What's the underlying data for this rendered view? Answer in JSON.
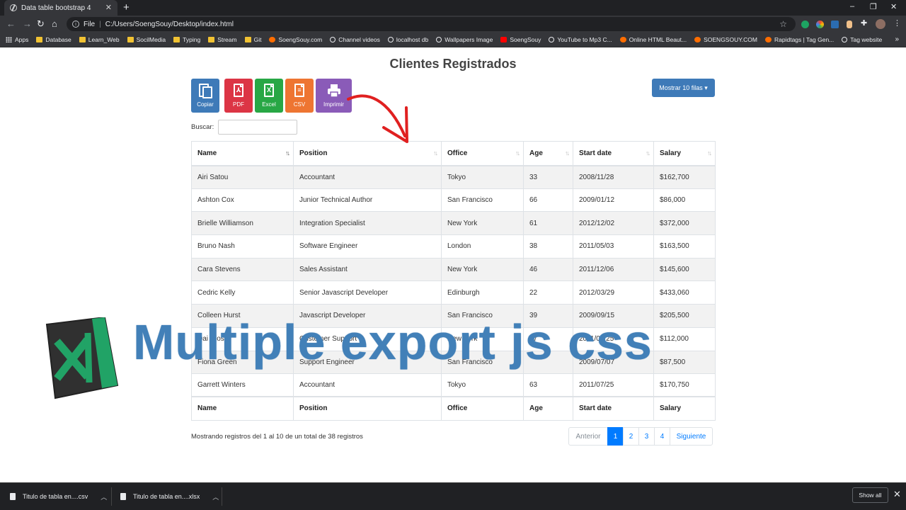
{
  "browser": {
    "tab_title": "Data table bootstrap 4",
    "tab_close": "✕",
    "new_tab": "+",
    "window_controls": [
      "–",
      "❐",
      "✕"
    ],
    "address": {
      "scheme": "File",
      "path": "C:/Users/SoengSouy/Desktop/index.html"
    },
    "bookmarks": [
      {
        "label": "Apps",
        "icon": "apps-icon"
      },
      {
        "label": "Database",
        "icon": "folder-icon"
      },
      {
        "label": "Learn_Web",
        "icon": "folder-icon"
      },
      {
        "label": "SocilMedia",
        "icon": "folder-icon"
      },
      {
        "label": "Typing",
        "icon": "folder-icon"
      },
      {
        "label": "Stream",
        "icon": "folder-icon"
      },
      {
        "label": "Git",
        "icon": "folder-icon"
      },
      {
        "label": "SoengSouy.com",
        "icon": "site-icon"
      },
      {
        "label": "Channel videos",
        "icon": "globe-icon"
      },
      {
        "label": "localhost db",
        "icon": "globe-icon"
      },
      {
        "label": "Wallpapers Image",
        "icon": "globe-icon"
      },
      {
        "label": "SoengSouy",
        "icon": "youtube-icon"
      },
      {
        "label": "YouTube to Mp3 C...",
        "icon": "globe-icon"
      },
      {
        "label": "Online HTML Beaut...",
        "icon": "site-icon"
      },
      {
        "label": "SOENGSOUY.COM",
        "icon": "site-icon"
      },
      {
        "label": "Rapidtags | Tag Gen...",
        "icon": "site-icon"
      },
      {
        "label": "Tag website",
        "icon": "globe-icon"
      }
    ]
  },
  "page": {
    "title": "Clientes Registrados",
    "export_buttons": [
      {
        "label": "Copiar",
        "icon": "copy-icon",
        "color": "#3e7ab8",
        "glyph": ""
      },
      {
        "label": "PDF",
        "icon": "pdf-icon",
        "color": "#dc3545",
        "glyph": "⅄"
      },
      {
        "label": "Excel",
        "icon": "excel-icon",
        "color": "#28a745",
        "glyph": "X"
      },
      {
        "label": "CSV",
        "icon": "csv-icon",
        "color": "#ee7532",
        "glyph": "≡"
      },
      {
        "label": "Imprimir",
        "icon": "print-icon",
        "color": "#8a5bb8",
        "glyph": ""
      }
    ],
    "rows_button": "Mostrar 10 filas ▾",
    "search_label": "Buscar:",
    "search_value": "",
    "table": {
      "columns": [
        "Name",
        "Position",
        "Office",
        "Age",
        "Start date",
        "Salary"
      ],
      "rows": [
        [
          "Airi Satou",
          "Accountant",
          "Tokyo",
          "33",
          "2008/11/28",
          "$162,700"
        ],
        [
          "Ashton Cox",
          "Junior Technical Author",
          "San Francisco",
          "66",
          "2009/01/12",
          "$86,000"
        ],
        [
          "Brielle Williamson",
          "Integration Specialist",
          "New York",
          "61",
          "2012/12/02",
          "$372,000"
        ],
        [
          "Bruno Nash",
          "Software Engineer",
          "London",
          "38",
          "2011/05/03",
          "$163,500"
        ],
        [
          "Cara Stevens",
          "Sales Assistant",
          "New York",
          "46",
          "2011/12/06",
          "$145,600"
        ],
        [
          "Cedric Kelly",
          "Senior Javascript Developer",
          "Edinburgh",
          "22",
          "2012/03/29",
          "$433,060"
        ],
        [
          "Colleen Hurst",
          "Javascript Developer",
          "San Francisco",
          "39",
          "2009/09/15",
          "$205,500"
        ],
        [
          "Dai Rios",
          "Customer Support",
          "New York",
          "27",
          "2011/01/25",
          "$112,000"
        ],
        [
          "Fiona Green",
          "Support Engineer",
          "San Francisco",
          "",
          "2009/07/07",
          "$87,500"
        ],
        [
          "Garrett Winters",
          "Accountant",
          "Tokyo",
          "63",
          "2011/07/25",
          "$170,750"
        ]
      ]
    },
    "info": "Mostrando registros del 1 al 10 de un total de 38 registros",
    "pagination": {
      "previous": "Anterior",
      "pages": [
        "1",
        "2",
        "3",
        "4"
      ],
      "active": "1",
      "next": "Siguiente"
    }
  },
  "overlay": {
    "headline": "Multiple export  js  css",
    "logo_color": "#21a366"
  },
  "downloads": {
    "items": [
      {
        "name": "Titulo de tabla en....csv"
      },
      {
        "name": "Titulo de tabla en....xlsx"
      }
    ],
    "show_all": "Show all",
    "close": "✕"
  }
}
